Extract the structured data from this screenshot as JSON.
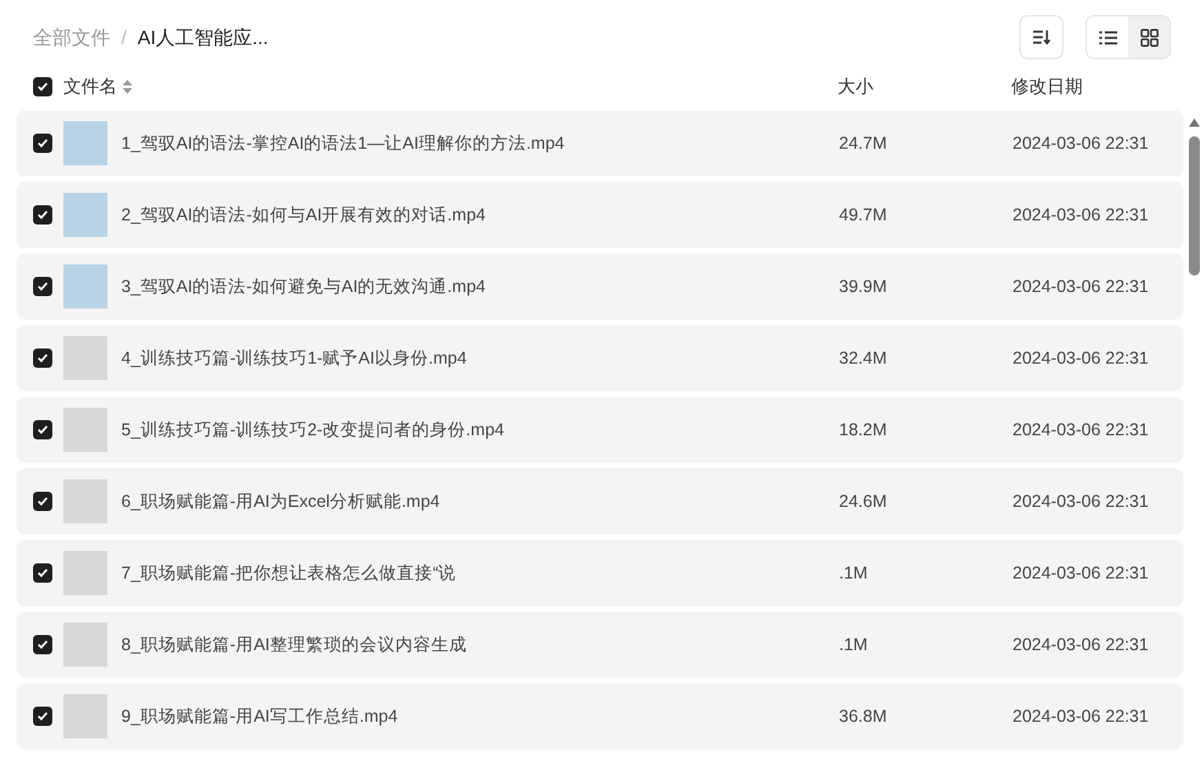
{
  "breadcrumb_separator": "/",
  "breadcrumb": [
    {
      "label": "全部文件",
      "current": false
    },
    {
      "label": "AI人工智能应...",
      "current": true
    }
  ],
  "toolbar": {
    "view_modes": [
      {
        "kind": "list",
        "selected": false
      },
      {
        "kind": "grid",
        "selected": true
      }
    ]
  },
  "table": {
    "all_checked": true,
    "columns": [
      "文件名",
      "大小",
      "修改日期"
    ],
    "rows": [
      {
        "checked": true,
        "name": "1_驾驭AI的语法-掌控AI的语法1—让AI理解你的方法.mp4",
        "size": "24.7M",
        "modified": "2024-03-06 22:31"
      },
      {
        "checked": true,
        "name": "2_驾驭AI的语法-如何与AI开展有效的对话.mp4",
        "size": "49.7M",
        "modified": "2024-03-06 22:31"
      },
      {
        "checked": true,
        "name": "3_驾驭AI的语法-如何避免与AI的无效沟通.mp4",
        "size": "39.9M",
        "modified": "2024-03-06 22:31"
      },
      {
        "checked": true,
        "name": "4_训练技巧篇-训练技巧1-赋予AI以身份.mp4",
        "size": "32.4M",
        "modified": "2024-03-06 22:31"
      },
      {
        "checked": true,
        "name": "5_训练技巧篇-训练技巧2-改变提问者的身份.mp4",
        "size": "18.2M",
        "modified": "2024-03-06 22:31"
      },
      {
        "checked": true,
        "name": "6_职场赋能篇-用AI为Excel分析赋能.mp4",
        "size": "24.6M",
        "modified": "2024-03-06 22:31"
      },
      {
        "checked": true,
        "name": "7_职场赋能篇-把你想让表格怎么做直接“说",
        "size": ".1M",
        "modified": "2024-03-06 22:31"
      },
      {
        "checked": true,
        "name": "8_职场赋能篇-用AI整理繁琐的会议内容生成",
        "size": ".1M",
        "modified": "2024-03-06 22:31"
      },
      {
        "checked": true,
        "name": "9_职场赋能篇-用AI写工作总结.mp4",
        "size": "36.8M",
        "modified": "2024-03-06 22:31"
      }
    ]
  }
}
